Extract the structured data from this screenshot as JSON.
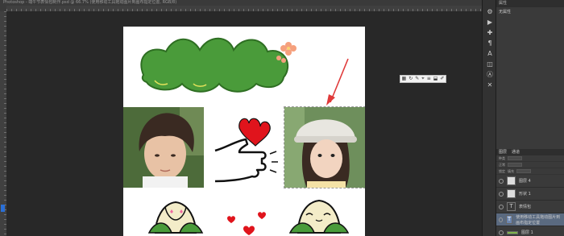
{
  "window": {
    "title": "Photoshop - 端午节表情包制作.psd @ 66.7% (使用移动工具拖动图片到画布指定位置, RGB/8)"
  },
  "rulers": {
    "marker_color": "#2a6fd6"
  },
  "mini_toolbar": {
    "icons": [
      "▦",
      "↻",
      "✎",
      "⌖",
      "≡",
      "⬓",
      "✐"
    ]
  },
  "tools_panel": {
    "icons": [
      "⚙",
      "▶",
      "✚",
      "¶",
      "A",
      "◫",
      "Ⓐ",
      "✕"
    ]
  },
  "properties_panel": {
    "header": "属性",
    "title": "无属性"
  },
  "layers_panel": {
    "tabs": [
      "图层",
      "通道"
    ],
    "controls": [
      "种类",
      "正常",
      "锁定",
      "填充"
    ],
    "layers": [
      {
        "name": "图层 4",
        "thumb": "",
        "selected": false
      },
      {
        "name": "形状 1",
        "thumb": "",
        "selected": false
      },
      {
        "name": "表情包",
        "thumb": "T",
        "selected": false
      },
      {
        "name": "使用移动工具拖动图片到画布指定位置",
        "thumb": "T",
        "selected": true
      },
      {
        "name": "图层 1",
        "thumb": "",
        "selected": false
      }
    ]
  },
  "colors": {
    "cloud_green": "#4a9b3a",
    "heart_red": "#e0141c",
    "flower_pink": "#f5a07d",
    "arrow_red": "#e03a3a"
  }
}
